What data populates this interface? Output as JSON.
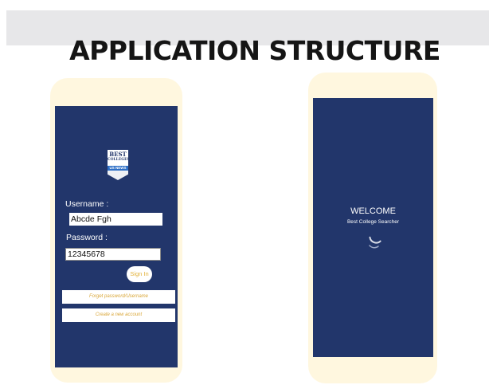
{
  "slide": {
    "title": "APPLICATION STRUCTURE"
  },
  "login_screen": {
    "logo": {
      "line1": "BEST",
      "line2": "COLLEGES",
      "band": "US NEWS"
    },
    "username_label": "Username :",
    "username_value": "Abcde Fgh",
    "password_label": "Password :",
    "password_value": "12345678",
    "sign_in_label": "Sign In",
    "forgot_label": "Forget password/Username",
    "create_account_label": "Create a new account"
  },
  "welcome_screen": {
    "title": "WELCOME",
    "subtitle": "Best College Searcher",
    "spinner_icon": "loading-spinner-icon"
  },
  "colors": {
    "screen_bg": "#22366b",
    "phone_frame": "#fff7df",
    "accent_gold": "#e3b33d",
    "band_gray": "#e7e7e9"
  }
}
